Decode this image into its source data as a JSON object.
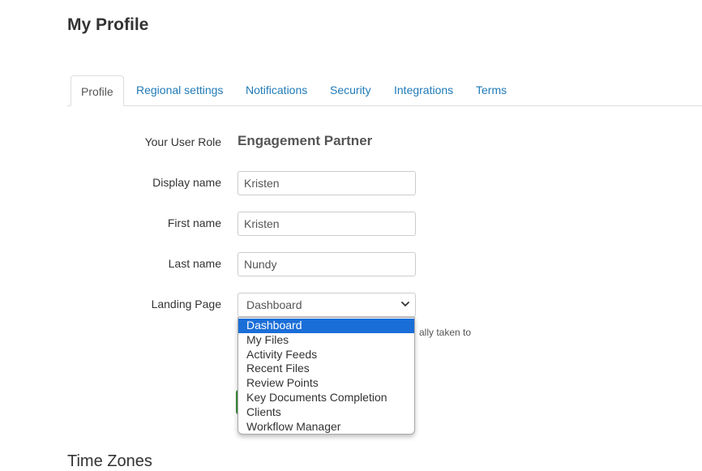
{
  "page": {
    "title": "My Profile"
  },
  "tabs": [
    {
      "label": "Profile",
      "active": true
    },
    {
      "label": "Regional settings"
    },
    {
      "label": "Notifications"
    },
    {
      "label": "Security"
    },
    {
      "label": "Integrations"
    },
    {
      "label": "Terms"
    }
  ],
  "form": {
    "role": {
      "label": "Your User Role",
      "value": "Engagement Partner"
    },
    "display_name": {
      "label": "Display name",
      "value": "Kristen"
    },
    "first_name": {
      "label": "First name",
      "value": "Kristen"
    },
    "last_name": {
      "label": "Last name",
      "value": "Nundy"
    },
    "landing_page": {
      "label": "Landing Page",
      "value": "Dashboard",
      "help_text_visible": "ally taken to",
      "options": [
        "Dashboard",
        "My Files",
        "Activity Feeds",
        "Recent Files",
        "Review Points",
        "Key Documents Completion",
        "Clients",
        "Workflow Manager"
      ]
    }
  },
  "sections": {
    "time_zones": "Time Zones"
  },
  "colors": {
    "link": "#1f7ab8",
    "selected_option": "#1a6ed8",
    "save_button": "#3e8f3e"
  }
}
